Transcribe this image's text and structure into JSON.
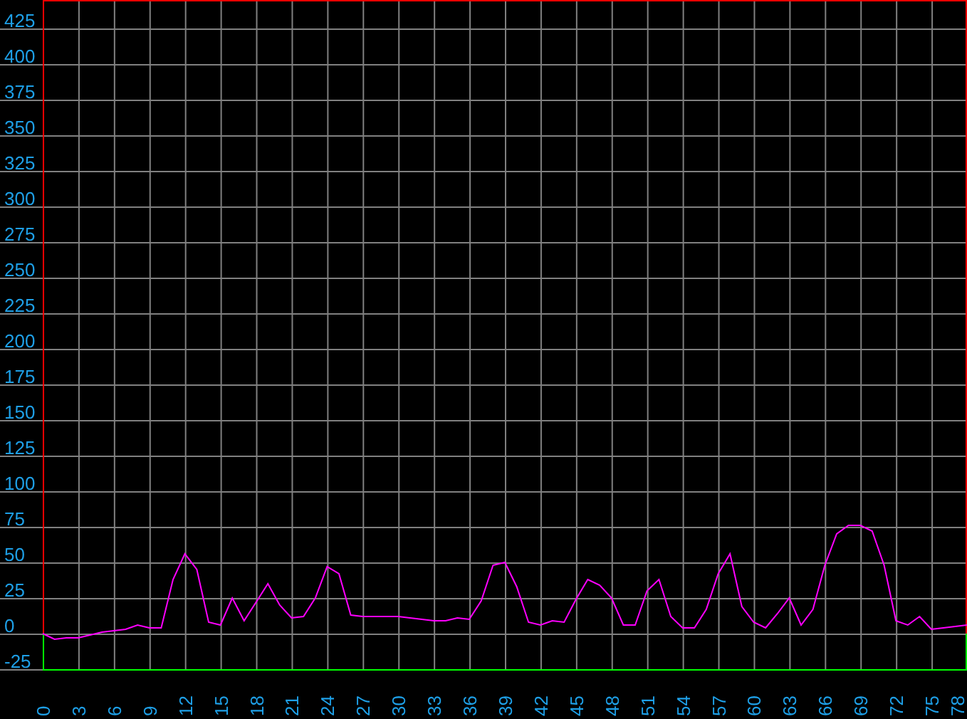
{
  "chart_data": {
    "type": "line",
    "grid": true,
    "xlim": [
      0,
      78
    ],
    "ylim": [
      -25,
      445
    ],
    "xticks": [
      0,
      3,
      6,
      9,
      12,
      15,
      18,
      21,
      24,
      27,
      30,
      33,
      36,
      39,
      42,
      45,
      48,
      51,
      54,
      57,
      60,
      63,
      66,
      69,
      72,
      75,
      78
    ],
    "yticks": [
      -25,
      0,
      25,
      50,
      75,
      100,
      125,
      150,
      175,
      200,
      225,
      250,
      275,
      300,
      325,
      350,
      375,
      400,
      425
    ],
    "x": [
      0,
      1,
      2,
      3,
      4,
      5,
      6,
      7,
      8,
      9,
      10,
      11,
      12,
      13,
      14,
      15,
      16,
      17,
      18,
      19,
      20,
      21,
      22,
      23,
      24,
      25,
      26,
      27,
      28,
      29,
      30,
      31,
      32,
      33,
      34,
      35,
      36,
      37,
      38,
      39,
      40,
      41,
      42,
      43,
      44,
      45,
      46,
      47,
      48,
      49,
      50,
      51,
      52,
      53,
      54,
      55,
      56,
      57,
      58,
      59,
      60,
      61,
      62,
      63,
      64,
      65,
      66,
      67,
      68,
      69,
      70,
      71,
      72,
      73,
      74,
      75,
      76,
      77,
      78
    ],
    "series": [
      {
        "color": "#ff00ff",
        "values": [
          0,
          -4,
          -3,
          -3,
          -1,
          1,
          2,
          3,
          6,
          4,
          4,
          38,
          56,
          45,
          8,
          6,
          25,
          9,
          22,
          35,
          20,
          11,
          12,
          25,
          47,
          42,
          13,
          12,
          12,
          12,
          12,
          11,
          10,
          9,
          9,
          11,
          10,
          23,
          48,
          50,
          33,
          8,
          6,
          9,
          8,
          24,
          38,
          34,
          25,
          6,
          6,
          30,
          38,
          12,
          4,
          4,
          17,
          42,
          56,
          19,
          8,
          4,
          14,
          25,
          6,
          17,
          48,
          70,
          76,
          76,
          72,
          48,
          9,
          6,
          12,
          3,
          4,
          5,
          6
        ]
      }
    ]
  }
}
